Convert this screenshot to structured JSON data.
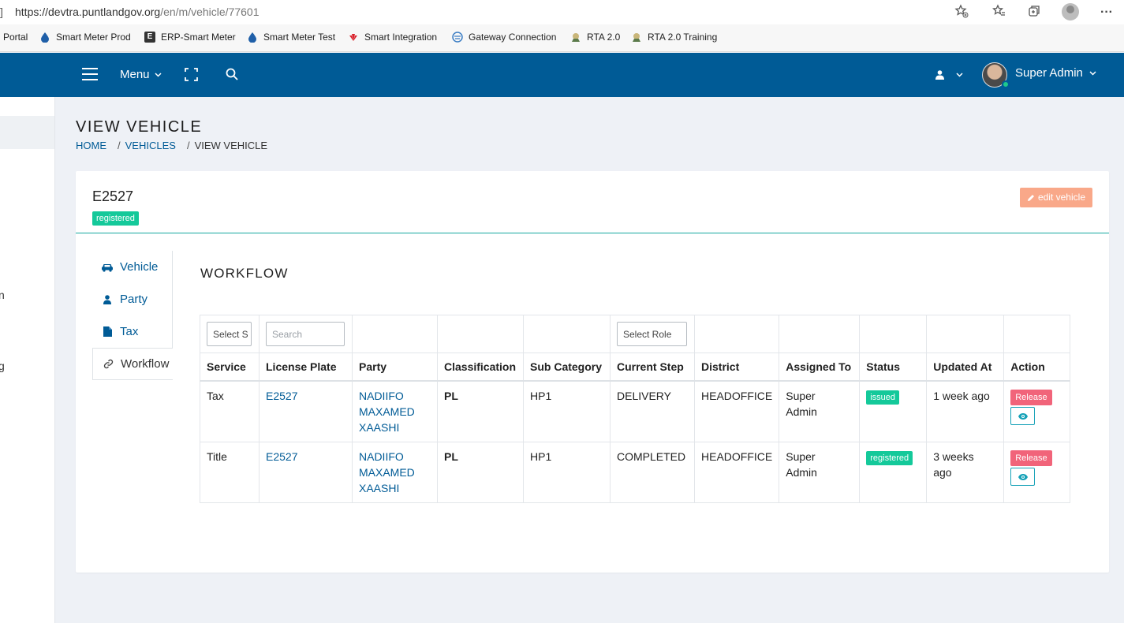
{
  "browser": {
    "lead_char": "]",
    "url_host": "https://devtra.puntlandgov.org",
    "url_path": "/en/m/vehicle/77601",
    "more_label": "···",
    "bookmarks": [
      {
        "label": "Portal",
        "icon": "none",
        "color": "#ffffff"
      },
      {
        "label": "Smart Meter Prod",
        "icon": "droplet-icon",
        "color": "#1f5fa8"
      },
      {
        "label": "ERP-Smart Meter",
        "icon": "e-square-icon",
        "color": "#333333"
      },
      {
        "label": "Smart Meter Test",
        "icon": "droplet-icon",
        "color": "#1f5fa8"
      },
      {
        "label": "Smart Integration",
        "icon": "huawei-icon",
        "color": "#d9232d"
      },
      {
        "label": "Gateway Connection",
        "icon": "globe-icon",
        "color": "#3b7dc4"
      },
      {
        "label": "RTA 2.0",
        "icon": "emblem-icon",
        "color": "#7a6a3a"
      },
      {
        "label": "RTA 2.0 Training",
        "icon": "emblem-icon",
        "color": "#7a6a3a"
      }
    ]
  },
  "header": {
    "menu_label": "Menu",
    "user_name": "Super Admin",
    "bg_color": "#005b96"
  },
  "sidebar": {
    "fragments": [
      "n",
      "g"
    ]
  },
  "page": {
    "title": "VIEW VEHICLE",
    "breadcrumb": [
      "HOME",
      "VEHICLES",
      "VIEW VEHICLE"
    ]
  },
  "vehicle": {
    "plate": "E2527",
    "status": "registered",
    "edit_label": "edit vehicle"
  },
  "tabs": [
    {
      "label": "Vehicle",
      "icon": "car-icon",
      "active": false
    },
    {
      "label": "Party",
      "icon": "user-icon",
      "active": false
    },
    {
      "label": "Tax",
      "icon": "file-icon",
      "active": false
    },
    {
      "label": "Workflow",
      "icon": "link-icon",
      "active": true
    }
  ],
  "workflow": {
    "title": "WORKFLOW",
    "filters": {
      "service": "Select S",
      "search_placeholder": "Search",
      "role": "Select Role"
    },
    "columns": [
      "Service",
      "License Plate",
      "Party",
      "Classification",
      "Sub Category",
      "Current Step",
      "District",
      "Assigned To",
      "Status",
      "Updated At",
      "Action"
    ],
    "rows": [
      {
        "service": "Tax",
        "plate": "E2527",
        "party_lines": [
          "NADIIFO",
          "MAXAMED",
          "XAASHI"
        ],
        "classification": "PL",
        "sub_category": "HP1",
        "current_step": "DELIVERY",
        "district": "HEADOFFICE",
        "assigned_lines": [
          "Super",
          "Admin"
        ],
        "status": "issued",
        "updated_lines": [
          "1 week ago"
        ],
        "release_label": "Release"
      },
      {
        "service": "Title",
        "plate": "E2527",
        "party_lines": [
          "NADIIFO",
          "MAXAMED",
          "XAASHI"
        ],
        "classification": "PL",
        "sub_category": "HP1",
        "current_step": "COMPLETED",
        "district": "HEADOFFICE",
        "assigned_lines": [
          "Super",
          "Admin"
        ],
        "status": "registered",
        "updated_lines": [
          "3 weeks",
          "ago"
        ],
        "release_label": "Release"
      }
    ]
  },
  "colors": {
    "status_green": "#14c99a",
    "release_red": "#f1647a",
    "edit_orange": "#f9a889",
    "link_blue": "#005b96",
    "accent_teal": "#13a7a0"
  }
}
